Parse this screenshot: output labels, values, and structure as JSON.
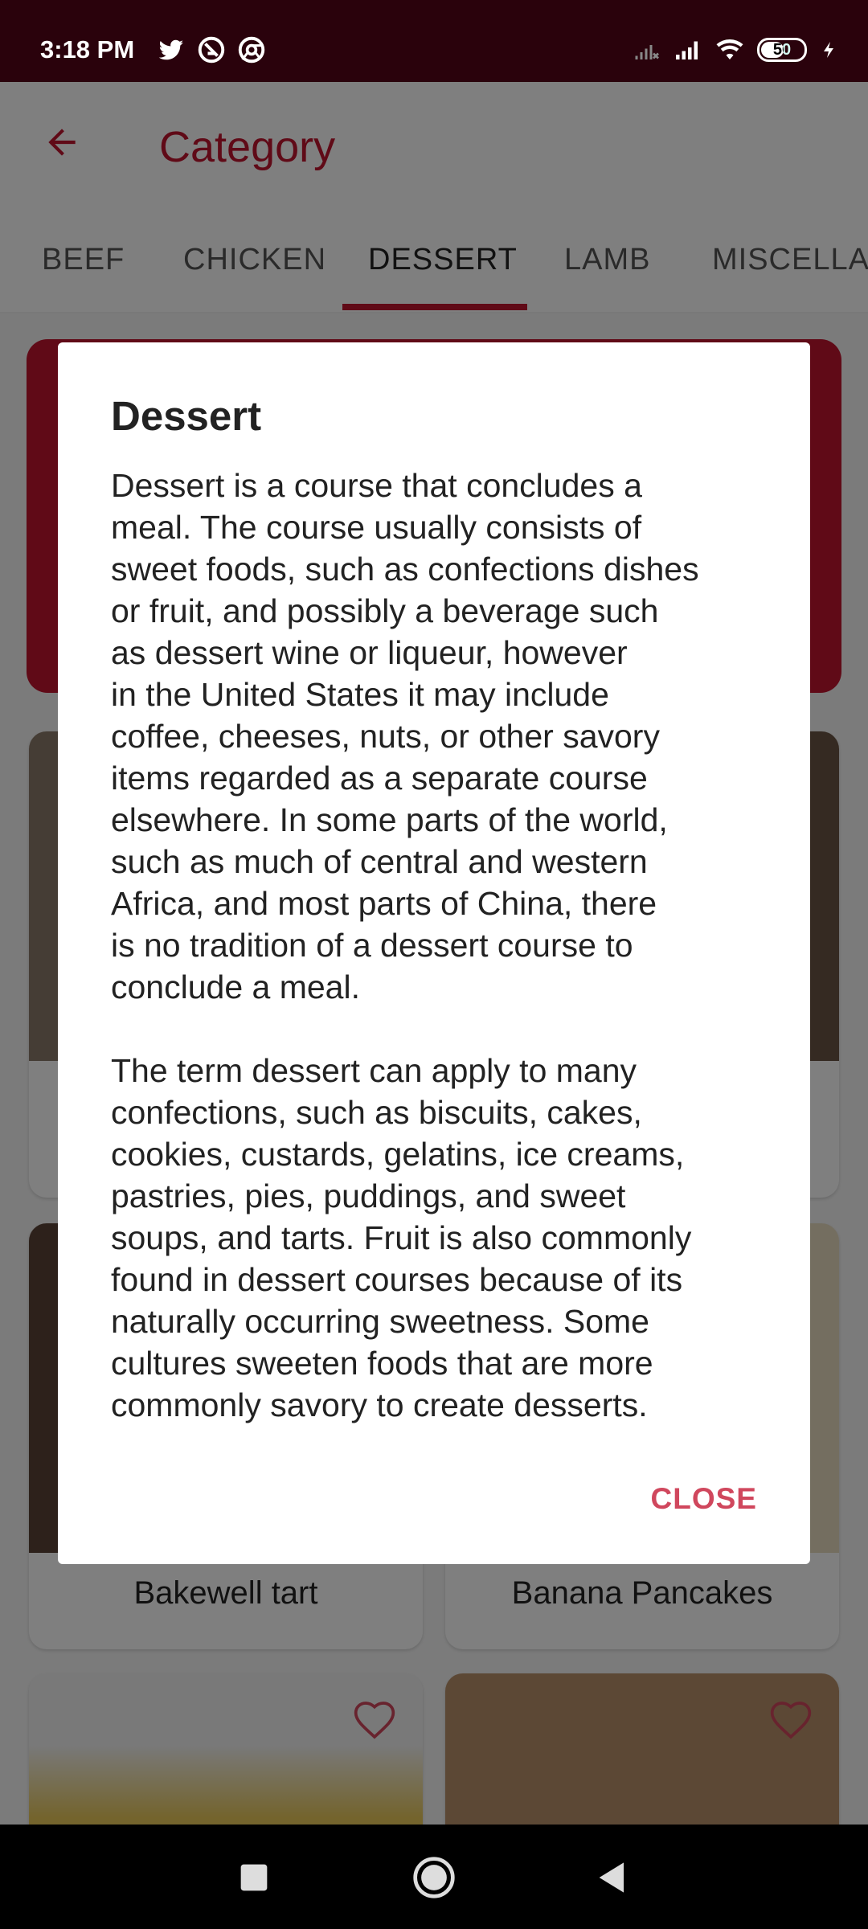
{
  "status_bar": {
    "time": "3:18 PM",
    "left_icons": [
      "twitter-icon",
      "app-notification-icon",
      "chrome-icon"
    ],
    "right_icons": [
      "no-signal-icon",
      "signal-icon",
      "wifi-icon"
    ],
    "battery": "50"
  },
  "app_bar": {
    "title": "Category"
  },
  "tabs": [
    "BEEF",
    "CHICKEN",
    "DESSERT",
    "LAMB",
    "MISCELLAN"
  ],
  "active_tab": "DESSERT",
  "cards": [
    {
      "label": "Bakewell tart"
    },
    {
      "label": "Banana Pancakes"
    }
  ],
  "dialog": {
    "title": "Dessert",
    "body": "Dessert is a course that concludes a\nmeal. The course usually consists of\nsweet foods, such as confections dishes\nor fruit, and possibly a beverage such\nas dessert wine or liqueur, however\nin the United States it may include\ncoffee, cheeses, nuts, or other savory\nitems regarded as a separate course\nelsewhere. In some parts of the world,\nsuch as much of central and western\nAfrica, and most parts of China, there\nis no tradition of a dessert course to\nconclude a meal.\n\nThe term dessert can apply to many\nconfections, such as biscuits, cakes,\ncookies, custards, gelatins, ice creams,\npastries, pies, puddings, and sweet\nsoups, and tarts. Fruit is also commonly\nfound in dessert courses because of its\nnaturally occurring sweetness. Some\ncultures sweeten foods that are more\ncommonly savory to create desserts.",
    "close_label": "CLOSE"
  },
  "colors": {
    "accent": "#c0152f",
    "status_bar": "#2a020c",
    "close": "#d0475d"
  }
}
